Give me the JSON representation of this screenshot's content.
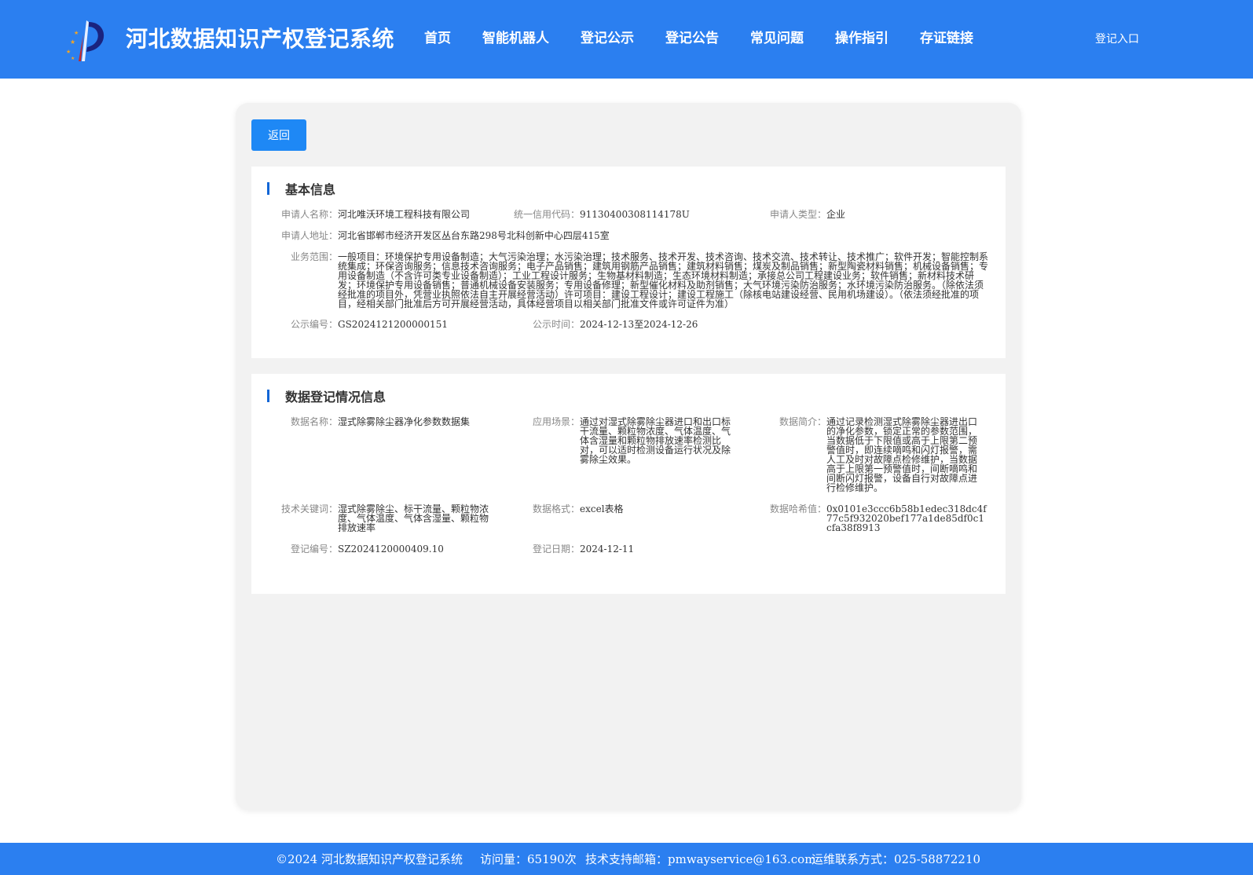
{
  "header": {
    "site_title": "河北数据知识产权登记系统",
    "nav": [
      "首页",
      "智能机器人",
      "登记公示",
      "登记公告",
      "常见问题",
      "操作指引",
      "存证链接"
    ],
    "login_label": "登记入口",
    "brand_color": "#2b7ff0"
  },
  "actions": {
    "back_label": "返回"
  },
  "basic_info": {
    "title": "基本信息",
    "applicant_name_label": "申请人名称：",
    "applicant_name": "河北唯沃环境工程科技有限公司",
    "credit_code_label": "统一信用代码：",
    "credit_code": "91130400308114178U",
    "applicant_type_label": "申请人类型：",
    "applicant_type": "企业",
    "address_label": "申请人地址：",
    "address": "河北省邯郸市经济开发区丛台东路298号北科创新中心四层415室",
    "scope_label": "业务范围：",
    "scope": "一般项目：环境保护专用设备制造；大气污染治理；水污染治理；技术服务、技术开发、技术咨询、技术交流、技术转让、技术推广；软件开发；智能控制系统集成；环保咨询服务；信息技术咨询服务；电子产品销售；建筑用钢筋产品销售；建筑材料销售；煤炭及制品销售；新型陶瓷材料销售；机械设备销售；专用设备制造（不含许可类专业设备制造）；工业工程设计服务；生物基材料制造；生态环境材料制造；承接总公司工程建设业务；软件销售；新材料技术研发；环境保护专用设备销售；普通机械设备安装服务；专用设备修理；新型催化材料及助剂销售；大气环境污染防治服务；水环境污染防治服务。（除依法须经批准的项目外，凭营业执照依法自主开展经营活动）许可项目：建设工程设计；建设工程施工（除核电站建设经营、民用机场建设）。（依法须经批准的项目，经相关部门批准后方可开展经营活动，具体经营项目以相关部门批准文件或许可证件为准）",
    "publicity_no_label": "公示编号：",
    "publicity_no": "GS2024121200000151",
    "publicity_time_label": "公示时间：",
    "publicity_time": "2024-12-13至2024-12-26"
  },
  "data_info": {
    "title": "数据登记情况信息",
    "data_name_label": "数据名称：",
    "data_name": "湿式除雾除尘器净化参数数据集",
    "scenario_label": "应用场景：",
    "scenario": "通过对湿式除雾除尘器进口和出口标干流量、颗粒物浓度、气体温度、气体含湿量和颗粒物排放速率检测比对，可以适时检测设备运行状况及除雾除尘效果。",
    "summary_label": "数据简介：",
    "summary": "通过记录检测湿式除雾除尘器进出口的净化参数，锁定正常的参数范围，当数据低于下限值或高于上限第二预警值时，即连续嘀鸣和闪灯报警，需人工及时对故障点检修维护，当数据高于上限第一预警值时，间断嘀鸣和间断闪灯报警，设备自行对故障点进行检修维护。",
    "keywords_label": "技术关键词：",
    "keywords": "湿式除雾除尘、标干流量、颗粒物浓度、气体温度、气体含湿量、颗粒物排放速率",
    "format_label": "数据格式：",
    "format": "excel表格",
    "hash_label": "数据哈希值：",
    "hash": "0x0101e3ccc6b58b1edec318dc4f77c5f932020bef177a1de85df0c1cfa38f8913",
    "reg_no_label": "登记编号：",
    "reg_no": "SZ2024120000409.10",
    "reg_date_label": "登记日期：",
    "reg_date": "2024-12-11"
  },
  "footer": {
    "copyright": "©2024 河北数据知识产权登记系统",
    "visits": "访问量：65190次",
    "email": "技术支持邮箱：pmwayservice@163.com",
    "contact": "运维联系方式：025-58872210"
  }
}
